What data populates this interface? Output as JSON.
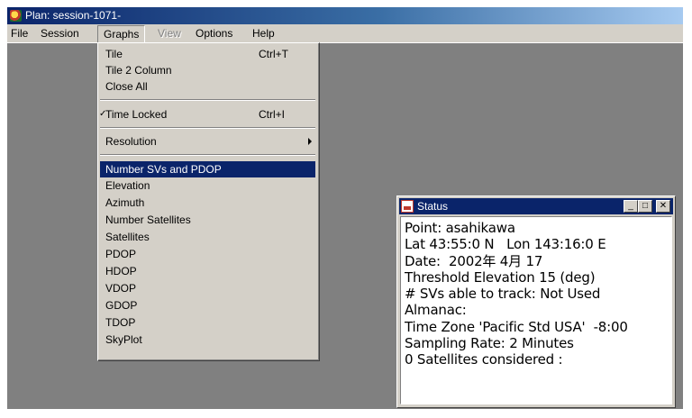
{
  "window": {
    "title": "Plan: session-1071-"
  },
  "menubar": {
    "items": [
      {
        "label": "File",
        "disabled": false
      },
      {
        "label": "Session",
        "disabled": false
      },
      {
        "label": "Graphs",
        "disabled": false
      },
      {
        "label": "View",
        "disabled": true
      },
      {
        "label": "Options",
        "disabled": false
      },
      {
        "label": "Help",
        "disabled": false
      }
    ]
  },
  "graphs_menu": {
    "tile": {
      "label": "Tile",
      "shortcut": "Ctrl+T"
    },
    "tile2": {
      "label": "Tile 2 Column"
    },
    "close_all": {
      "label": "Close All"
    },
    "time_locked": {
      "label": "Time Locked",
      "shortcut": "Ctrl+I",
      "check": "✓",
      "checked": true
    },
    "resolution": {
      "label": "Resolution"
    },
    "graphs": [
      "Number SVs and PDOP",
      "Elevation",
      "Azimuth",
      "Number Satellites",
      "Satellites",
      "PDOP",
      "HDOP",
      "VDOP",
      "GDOP",
      "TDOP",
      "SkyPlot"
    ],
    "highlighted": "Number SVs and PDOP"
  },
  "status_window": {
    "title": "Status",
    "buttons": {
      "minimize": "_",
      "maximize": "□",
      "close": "✕"
    },
    "lines": [
      "Point: asahikawa",
      "Lat 43:55:0 N   Lon 143:16:0 E",
      "Date:  2002年 4月 17",
      "Threshold Elevation 15 (deg)",
      "# SVs able to track: Not Used",
      "Almanac:",
      "Time Zone 'Pacific Std USA'  -8:00",
      "Sampling Rate: 2 Minutes",
      "0 Satellites considered :"
    ]
  },
  "colors": {
    "titlebar_start": "#0a246a",
    "titlebar_end": "#a6caf0",
    "menu_highlight": "#0a246a",
    "workspace": "#808080",
    "chrome": "#d4d0c8"
  }
}
